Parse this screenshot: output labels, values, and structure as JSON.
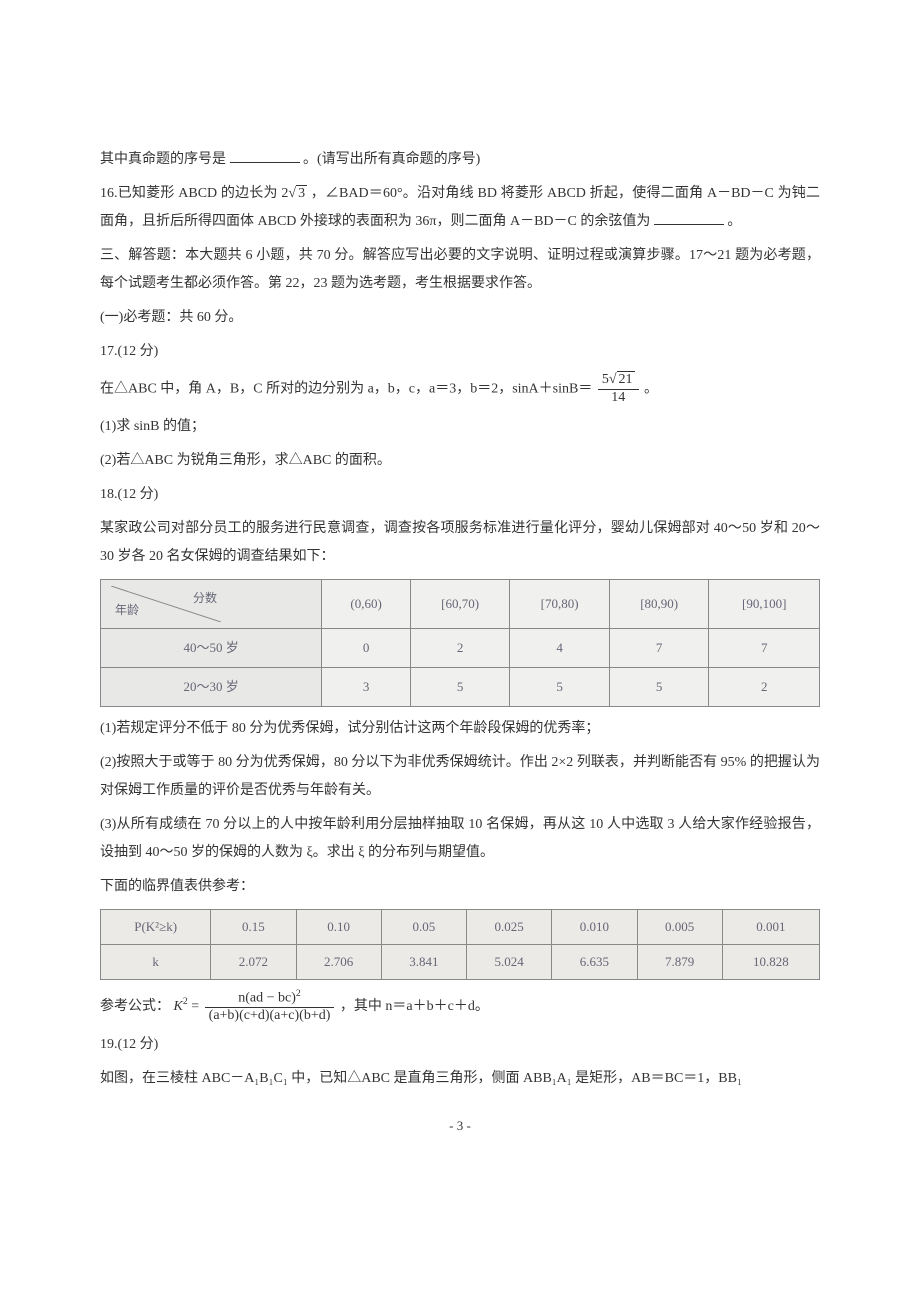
{
  "p15": {
    "line": "其中真命题的序号是",
    "suffix": "。(请写出所有真命题的序号)"
  },
  "p16": {
    "prefix": "16.已知菱形 ABCD 的边长为 2",
    "sqrt3": "3",
    "mid": "，∠BAD＝60°。沿对角线 BD 将菱形 ABCD 折起，使得二面角 A－BD－C 为钝二面角，且折后所得四面体 ABCD 外接球的表面积为 36π，则二面角 A－BD－C 的余弦值为",
    "suffix": "。"
  },
  "section3": {
    "intro1": "三、解答题：本大题共 6 小题，共 70 分。解答应写出必要的文字说明、证明过程或演算步骤。17～21 题为必考题，每个试题考生都必须作答。第 22，23 题为选考题，考生根据要求作答。",
    "intro2": "(一)必考题：共 60 分。"
  },
  "q17": {
    "head": "17.(12 分)",
    "line1_a": "在△ABC 中，角 A，B，C 所对的边分别为 a，b，c，a＝3，b＝2，sinA＋sinB＝",
    "frac_num_a": "5",
    "frac_num_sqrt": "21",
    "frac_den": "14",
    "line1_b": "。",
    "part1": "(1)求 sinB 的值；",
    "part2": "(2)若△ABC 为锐角三角形，求△ABC 的面积。"
  },
  "q18": {
    "head": "18.(12 分)",
    "intro": "某家政公司对部分员工的服务进行民意调查，调查按各项服务标准进行量化评分，婴幼儿保姆部对 40～50 岁和 20～30 岁各 20 名女保姆的调查结果如下：",
    "table1": {
      "diag_age": "年龄",
      "diag_score": "分数",
      "cols": [
        "(0,60)",
        "[60,70)",
        "[70,80)",
        "[80,90)",
        "[90,100]"
      ],
      "rows": [
        {
          "label": "40～50 岁",
          "cells": [
            "0",
            "2",
            "4",
            "7",
            "7"
          ]
        },
        {
          "label": "20～30 岁",
          "cells": [
            "3",
            "5",
            "5",
            "5",
            "2"
          ]
        }
      ]
    },
    "part1": "(1)若规定评分不低于 80 分为优秀保姆，试分别估计这两个年龄段保姆的优秀率；",
    "part2": "(2)按照大于或等于 80 分为优秀保姆，80 分以下为非优秀保姆统计。作出 2×2 列联表，并判断能否有 95% 的把握认为对保姆工作质量的评价是否优秀与年龄有关。",
    "part3": "(3)从所有成绩在 70 分以上的人中按年龄利用分层抽样抽取 10 名保姆，再从这 10 人中选取 3 人给大家作经验报告，设抽到 40～50 岁的保姆的人数为 ξ。求出 ξ 的分布列与期望值。",
    "ref_intro": "下面的临界值表供参考：",
    "table2": {
      "row1": [
        "P(K²≥k)",
        "0.15",
        "0.10",
        "0.05",
        "0.025",
        "0.010",
        "0.005",
        "0.001"
      ],
      "row2": [
        "k",
        "2.072",
        "2.706",
        "3.841",
        "5.024",
        "6.635",
        "7.879",
        "10.828"
      ]
    },
    "formula_label": "参考公式：",
    "formula_lhs": "K",
    "formula_num_a": "n(ad − bc)",
    "formula_den": "(a+b)(c+d)(a+c)(b+d)",
    "formula_where": "，其中 n＝a＋b＋c＋d。"
  },
  "q19": {
    "head": "19.(12 分)",
    "line": "如图，在三棱柱 ABC－A₁B₁C₁ 中，已知△ABC 是直角三角形，侧面 ABB₁A₁ 是矩形，AB＝BC＝1，BB₁"
  },
  "page_num": "- 3 -"
}
